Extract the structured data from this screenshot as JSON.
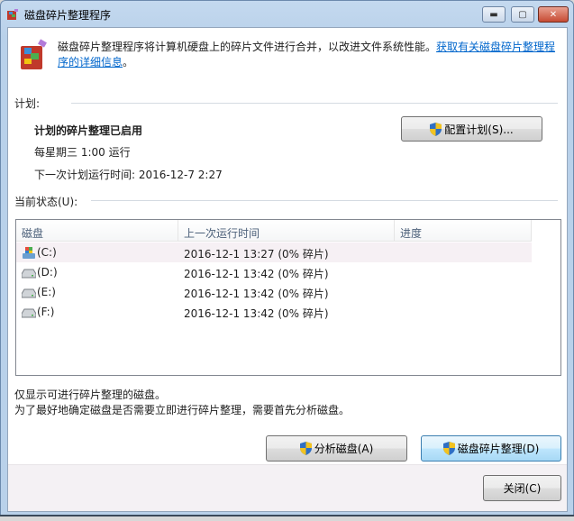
{
  "window": {
    "title": "磁盘碎片整理程序"
  },
  "intro": {
    "text": "磁盘碎片整理程序将计算机硬盘上的碎片文件进行合并，以改进文件系统性能。",
    "link": "获取有关磁盘碎片整理程序的详细信息",
    "link_line1": "获取有关磁盘碎片整理程",
    "link_line2": "序的详细信息",
    "suffix": "。"
  },
  "schedule": {
    "label": "计划:",
    "status": "计划的碎片整理已启用",
    "frequency": "每星期三  1:00 运行",
    "next_run": "下一次计划运行时间: 2016-12-7 2:27",
    "configure_button": "配置计划(S)..."
  },
  "current": {
    "label": "当前状态(U):",
    "columns": [
      "磁盘",
      "上一次运行时间",
      "进度"
    ],
    "rows": [
      {
        "disk": "(C:)",
        "last_run": "2016-12-1 13:27 (0% 碎片)",
        "progress": ""
      },
      {
        "disk": "(D:)",
        "last_run": "2016-12-1 13:42 (0% 碎片)",
        "progress": ""
      },
      {
        "disk": "(E:)",
        "last_run": "2016-12-1 13:42 (0% 碎片)",
        "progress": ""
      },
      {
        "disk": "(F:)",
        "last_run": "2016-12-1 13:42 (0% 碎片)",
        "progress": ""
      }
    ]
  },
  "notes": [
    "仅显示可进行碎片整理的磁盘。",
    "为了最好地确定磁盘是否需要立即进行碎片整理，需要首先分析磁盘。"
  ],
  "buttons": {
    "analyze": "分析磁盘(A)",
    "defragment": "磁盘碎片整理(D)",
    "close": "关闭(C)"
  }
}
